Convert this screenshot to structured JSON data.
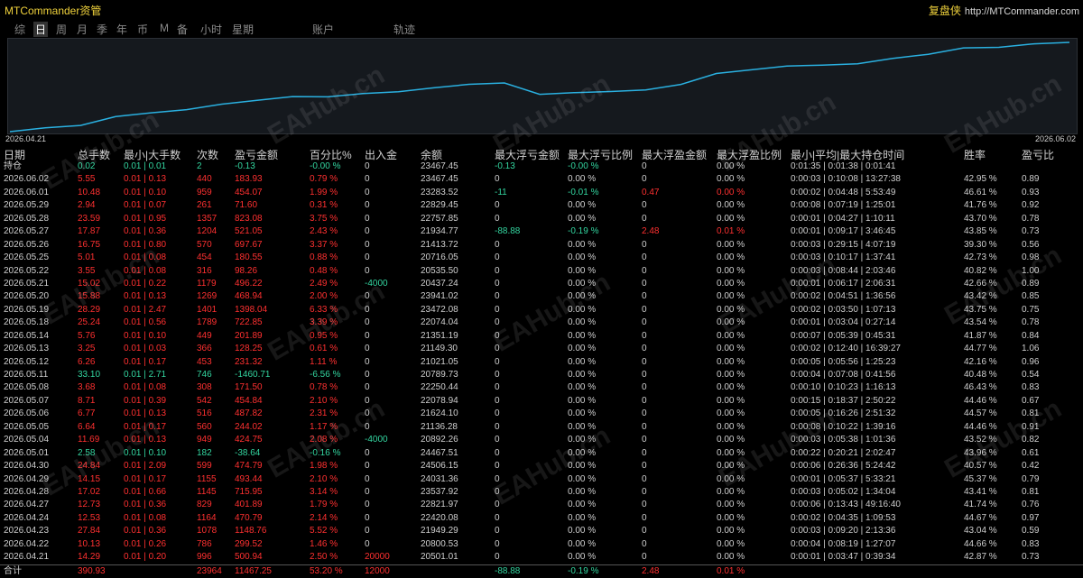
{
  "app": {
    "title": "MTCommander资管",
    "brand_cn": "复盘侠",
    "brand_url": "http://MTCommander.com"
  },
  "tabs": [
    "综",
    "日",
    "周",
    "月",
    "季",
    "年",
    "币",
    "M",
    "备",
    "小时",
    "星期",
    "账户",
    "轨迹"
  ],
  "active_tab": "日",
  "chart": {
    "start_date": "2026.04.21",
    "end_date": "2026.06.02",
    "line_color": "#2ab0e0",
    "series": [
      20501.01,
      20800.53,
      21949.29,
      22420.08,
      22821.97,
      23537.92,
      24031.36,
      24506.15,
      24467.51,
      20892.26,
      21136.28,
      21624.1,
      22078.94,
      22250.44,
      20789.73,
      21021.05,
      21149.3,
      21351.19,
      22074.04,
      23472.08,
      23941.02,
      20437.24,
      20535.5,
      20716.05,
      21413.72,
      21934.77,
      22757.85,
      22829.45,
      23283.52,
      23467.45
    ]
  },
  "headers": [
    "日期",
    "总手数",
    "最小|大手数",
    "次数",
    "盈亏金额",
    "百分比%",
    "出入金",
    "余额",
    "最大浮亏金额",
    "最大浮亏比例",
    "最大浮盈金额",
    "最大浮盈比例",
    "最小|平均|最大持仓时间",
    "胜率",
    "盈亏比"
  ],
  "rows": [
    {
      "date": "持仓",
      "lots": "0.02",
      "minmax": "0.01 | 0.01",
      "count": "2",
      "pnl": "-0.13",
      "pct": "-0.00 %",
      "flow": "0",
      "bal": "23467.45",
      "mfl": "-0.13",
      "mflp": "-0.00 %",
      "mfp": "0",
      "mfpp": "0.00 %",
      "hold": "0:01:35 | 0:01:38 | 0:01:41",
      "win": "",
      "rr": "",
      "c": "g"
    },
    {
      "date": "2026.06.02",
      "lots": "5.55",
      "minmax": "0.01 | 0.13",
      "count": "440",
      "pnl": "183.93",
      "pct": "0.79 %",
      "flow": "0",
      "bal": "23467.45",
      "mfl": "0",
      "mflp": "0.00 %",
      "mfp": "0",
      "mfpp": "0.00 %",
      "hold": "0:00:03 | 0:10:08 | 13:27:38",
      "win": "42.95 %",
      "rr": "0.89",
      "c": "r"
    },
    {
      "date": "2026.06.01",
      "lots": "10.48",
      "minmax": "0.01 | 0.10",
      "count": "959",
      "pnl": "454.07",
      "pct": "1.99 %",
      "flow": "0",
      "bal": "23283.52",
      "mfl": "-11",
      "mflp": "-0.01 %",
      "mfp": "0.47",
      "mfpp": "0.00 %",
      "hold": "0:00:02 | 0:04:48 | 5:53:49",
      "win": "46.61 %",
      "rr": "0.93",
      "c": "r"
    },
    {
      "date": "2026.05.29",
      "lots": "2.94",
      "minmax": "0.01 | 0.07",
      "count": "261",
      "pnl": "71.60",
      "pct": "0.31 %",
      "flow": "0",
      "bal": "22829.45",
      "mfl": "0",
      "mflp": "0.00 %",
      "mfp": "0",
      "mfpp": "0.00 %",
      "hold": "0:00:08 | 0:07:19 | 1:25:01",
      "win": "41.76 %",
      "rr": "0.92",
      "c": "r"
    },
    {
      "date": "2026.05.28",
      "lots": "23.59",
      "minmax": "0.01 | 0.95",
      "count": "1357",
      "pnl": "823.08",
      "pct": "3.75 %",
      "flow": "0",
      "bal": "22757.85",
      "mfl": "0",
      "mflp": "0.00 %",
      "mfp": "0",
      "mfpp": "0.00 %",
      "hold": "0:00:01 | 0:04:27 | 1:10:11",
      "win": "43.70 %",
      "rr": "0.78",
      "c": "r"
    },
    {
      "date": "2026.05.27",
      "lots": "17.87",
      "minmax": "0.01 | 0.36",
      "count": "1204",
      "pnl": "521.05",
      "pct": "2.43 %",
      "flow": "0",
      "bal": "21934.77",
      "mfl": "-88.88",
      "mflp": "-0.19 %",
      "mfp": "2.48",
      "mfpp": "0.01 %",
      "hold": "0:00:01 | 0:09:17 | 3:46:45",
      "win": "43.85 %",
      "rr": "0.73",
      "c": "r"
    },
    {
      "date": "2026.05.26",
      "lots": "16.75",
      "minmax": "0.01 | 0.80",
      "count": "570",
      "pnl": "697.67",
      "pct": "3.37 %",
      "flow": "0",
      "bal": "21413.72",
      "mfl": "0",
      "mflp": "0.00 %",
      "mfp": "0",
      "mfpp": "0.00 %",
      "hold": "0:00:03 | 0:29:15 | 4:07:19",
      "win": "39.30 %",
      "rr": "0.56",
      "c": "r"
    },
    {
      "date": "2026.05.25",
      "lots": "5.01",
      "minmax": "0.01 | 0.08",
      "count": "454",
      "pnl": "180.55",
      "pct": "0.88 %",
      "flow": "0",
      "bal": "20716.05",
      "mfl": "0",
      "mflp": "0.00 %",
      "mfp": "0",
      "mfpp": "0.00 %",
      "hold": "0:00:03 | 0:10:17 | 1:37:41",
      "win": "42.73 %",
      "rr": "0.98",
      "c": "r"
    },
    {
      "date": "2026.05.22",
      "lots": "3.55",
      "minmax": "0.01 | 0.08",
      "count": "316",
      "pnl": "98.26",
      "pct": "0.48 %",
      "flow": "0",
      "bal": "20535.50",
      "mfl": "0",
      "mflp": "0.00 %",
      "mfp": "0",
      "mfpp": "0.00 %",
      "hold": "0:00:03 | 0:08:44 | 2:03:46",
      "win": "40.82 %",
      "rr": "1.00",
      "c": "r"
    },
    {
      "date": "2026.05.21",
      "lots": "15.02",
      "minmax": "0.01 | 0.22",
      "count": "1179",
      "pnl": "496.22",
      "pct": "2.49 %",
      "flow": "-4000",
      "bal": "20437.24",
      "mfl": "0",
      "mflp": "0.00 %",
      "mfp": "0",
      "mfpp": "0.00 %",
      "hold": "0:00:01 | 0:06:17 | 2:06:31",
      "win": "42.66 %",
      "rr": "0.89",
      "c": "r"
    },
    {
      "date": "2026.05.20",
      "lots": "15.88",
      "minmax": "0.01 | 0.13",
      "count": "1269",
      "pnl": "468.94",
      "pct": "2.00 %",
      "flow": "0",
      "bal": "23941.02",
      "mfl": "0",
      "mflp": "0.00 %",
      "mfp": "0",
      "mfpp": "0.00 %",
      "hold": "0:00:02 | 0:04:51 | 1:36:56",
      "win": "43.42 %",
      "rr": "0.85",
      "c": "r"
    },
    {
      "date": "2026.05.19",
      "lots": "28.29",
      "minmax": "0.01 | 2.47",
      "count": "1401",
      "pnl": "1398.04",
      "pct": "6.33 %",
      "flow": "0",
      "bal": "23472.08",
      "mfl": "0",
      "mflp": "0.00 %",
      "mfp": "0",
      "mfpp": "0.00 %",
      "hold": "0:00:02 | 0:03:50 | 1:07:13",
      "win": "43.75 %",
      "rr": "0.75",
      "c": "r"
    },
    {
      "date": "2026.05.18",
      "lots": "25.24",
      "minmax": "0.01 | 0.56",
      "count": "1789",
      "pnl": "722.85",
      "pct": "3.39 %",
      "flow": "0",
      "bal": "22074.04",
      "mfl": "0",
      "mflp": "0.00 %",
      "mfp": "0",
      "mfpp": "0.00 %",
      "hold": "0:00:01 | 0:03:04 | 0:27:14",
      "win": "43.54 %",
      "rr": "0.78",
      "c": "r"
    },
    {
      "date": "2026.05.14",
      "lots": "5.76",
      "minmax": "0.01 | 0.10",
      "count": "449",
      "pnl": "201.89",
      "pct": "0.95 %",
      "flow": "0",
      "bal": "21351.19",
      "mfl": "0",
      "mflp": "0.00 %",
      "mfp": "0",
      "mfpp": "0.00 %",
      "hold": "0:00:07 | 0:05:39 | 0:45:31",
      "win": "41.87 %",
      "rr": "0.84",
      "c": "r"
    },
    {
      "date": "2026.05.13",
      "lots": "3.25",
      "minmax": "0.01 | 0.03",
      "count": "366",
      "pnl": "128.25",
      "pct": "0.61 %",
      "flow": "0",
      "bal": "21149.30",
      "mfl": "0",
      "mflp": "0.00 %",
      "mfp": "0",
      "mfpp": "0.00 %",
      "hold": "0:00:02 | 0:12:40 | 16:39:27",
      "win": "44.77 %",
      "rr": "1.06",
      "c": "r"
    },
    {
      "date": "2026.05.12",
      "lots": "6.26",
      "minmax": "0.01 | 0.17",
      "count": "453",
      "pnl": "231.32",
      "pct": "1.11 %",
      "flow": "0",
      "bal": "21021.05",
      "mfl": "0",
      "mflp": "0.00 %",
      "mfp": "0",
      "mfpp": "0.00 %",
      "hold": "0:00:05 | 0:05:56 | 1:25:23",
      "win": "42.16 %",
      "rr": "0.96",
      "c": "r"
    },
    {
      "date": "2026.05.11",
      "lots": "33.10",
      "minmax": "0.01 | 2.71",
      "count": "746",
      "pnl": "-1460.71",
      "pct": "-6.56 %",
      "flow": "0",
      "bal": "20789.73",
      "mfl": "0",
      "mflp": "0.00 %",
      "mfp": "0",
      "mfpp": "0.00 %",
      "hold": "0:00:04 | 0:07:08 | 0:41:56",
      "win": "40.48 %",
      "rr": "0.54",
      "c": "g"
    },
    {
      "date": "2026.05.08",
      "lots": "3.68",
      "minmax": "0.01 | 0.08",
      "count": "308",
      "pnl": "171.50",
      "pct": "0.78 %",
      "flow": "0",
      "bal": "22250.44",
      "mfl": "0",
      "mflp": "0.00 %",
      "mfp": "0",
      "mfpp": "0.00 %",
      "hold": "0:00:10 | 0:10:23 | 1:16:13",
      "win": "46.43 %",
      "rr": "0.83",
      "c": "r"
    },
    {
      "date": "2026.05.07",
      "lots": "8.71",
      "minmax": "0.01 | 0.39",
      "count": "542",
      "pnl": "454.84",
      "pct": "2.10 %",
      "flow": "0",
      "bal": "22078.94",
      "mfl": "0",
      "mflp": "0.00 %",
      "mfp": "0",
      "mfpp": "0.00 %",
      "hold": "0:00:15 | 0:18:37 | 2:50:22",
      "win": "44.46 %",
      "rr": "0.67",
      "c": "r"
    },
    {
      "date": "2026.05.06",
      "lots": "6.77",
      "minmax": "0.01 | 0.13",
      "count": "516",
      "pnl": "487.82",
      "pct": "2.31 %",
      "flow": "0",
      "bal": "21624.10",
      "mfl": "0",
      "mflp": "0.00 %",
      "mfp": "0",
      "mfpp": "0.00 %",
      "hold": "0:00:05 | 0:16:26 | 2:51:32",
      "win": "44.57 %",
      "rr": "0.81",
      "c": "r"
    },
    {
      "date": "2026.05.05",
      "lots": "6.64",
      "minmax": "0.01 | 0.17",
      "count": "560",
      "pnl": "244.02",
      "pct": "1.17 %",
      "flow": "0",
      "bal": "21136.28",
      "mfl": "0",
      "mflp": "0.00 %",
      "mfp": "0",
      "mfpp": "0.00 %",
      "hold": "0:00:08 | 0:10:22 | 1:39:16",
      "win": "44.46 %",
      "rr": "0.91",
      "c": "r"
    },
    {
      "date": "2026.05.04",
      "lots": "11.69",
      "minmax": "0.01 | 0.13",
      "count": "949",
      "pnl": "424.75",
      "pct": "2.08 %",
      "flow": "-4000",
      "bal": "20892.26",
      "mfl": "0",
      "mflp": "0.00 %",
      "mfp": "0",
      "mfpp": "0.00 %",
      "hold": "0:00:03 | 0:05:38 | 1:01:36",
      "win": "43.52 %",
      "rr": "0.82",
      "c": "r"
    },
    {
      "date": "2026.05.01",
      "lots": "2.58",
      "minmax": "0.01 | 0.10",
      "count": "182",
      "pnl": "-38.64",
      "pct": "-0.16 %",
      "flow": "0",
      "bal": "24467.51",
      "mfl": "0",
      "mflp": "0.00 %",
      "mfp": "0",
      "mfpp": "0.00 %",
      "hold": "0:00:22 | 0:20:21 | 2:02:47",
      "win": "43.96 %",
      "rr": "0.61",
      "c": "g"
    },
    {
      "date": "2026.04.30",
      "lots": "24.84",
      "minmax": "0.01 | 2.09",
      "count": "599",
      "pnl": "474.79",
      "pct": "1.98 %",
      "flow": "0",
      "bal": "24506.15",
      "mfl": "0",
      "mflp": "0.00 %",
      "mfp": "0",
      "mfpp": "0.00 %",
      "hold": "0:00:06 | 0:26:36 | 5:24:42",
      "win": "40.57 %",
      "rr": "0.42",
      "c": "r"
    },
    {
      "date": "2026.04.29",
      "lots": "14.15",
      "minmax": "0.01 | 0.17",
      "count": "1155",
      "pnl": "493.44",
      "pct": "2.10 %",
      "flow": "0",
      "bal": "24031.36",
      "mfl": "0",
      "mflp": "0.00 %",
      "mfp": "0",
      "mfpp": "0.00 %",
      "hold": "0:00:01 | 0:05:37 | 5:33:21",
      "win": "45.37 %",
      "rr": "0.79",
      "c": "r"
    },
    {
      "date": "2026.04.28",
      "lots": "17.02",
      "minmax": "0.01 | 0.66",
      "count": "1145",
      "pnl": "715.95",
      "pct": "3.14 %",
      "flow": "0",
      "bal": "23537.92",
      "mfl": "0",
      "mflp": "0.00 %",
      "mfp": "0",
      "mfpp": "0.00 %",
      "hold": "0:00:03 | 0:05:02 | 1:34:04",
      "win": "43.41 %",
      "rr": "0.81",
      "c": "r"
    },
    {
      "date": "2026.04.27",
      "lots": "12.73",
      "minmax": "0.01 | 0.36",
      "count": "829",
      "pnl": "401.89",
      "pct": "1.79 %",
      "flow": "0",
      "bal": "22821.97",
      "mfl": "0",
      "mflp": "0.00 %",
      "mfp": "0",
      "mfpp": "0.00 %",
      "hold": "0:00:06 | 0:13:43 | 49:16:40",
      "win": "41.74 %",
      "rr": "0.76",
      "c": "r"
    },
    {
      "date": "2026.04.24",
      "lots": "12.53",
      "minmax": "0.01 | 0.08",
      "count": "1164",
      "pnl": "470.79",
      "pct": "2.14 %",
      "flow": "0",
      "bal": "22420.08",
      "mfl": "0",
      "mflp": "0.00 %",
      "mfp": "0",
      "mfpp": "0.00 %",
      "hold": "0:00:02 | 0:04:35 | 1:09:53",
      "win": "44.67 %",
      "rr": "0.97",
      "c": "r"
    },
    {
      "date": "2026.04.23",
      "lots": "27.84",
      "minmax": "0.01 | 0.36",
      "count": "1078",
      "pnl": "1148.76",
      "pct": "5.52 %",
      "flow": "0",
      "bal": "21949.29",
      "mfl": "0",
      "mflp": "0.00 %",
      "mfp": "0",
      "mfpp": "0.00 %",
      "hold": "0:00:03 | 0:09:20 | 2:13:36",
      "win": "43.04 %",
      "rr": "0.59",
      "c": "r"
    },
    {
      "date": "2026.04.22",
      "lots": "10.13",
      "minmax": "0.01 | 0.26",
      "count": "786",
      "pnl": "299.52",
      "pct": "1.46 %",
      "flow": "0",
      "bal": "20800.53",
      "mfl": "0",
      "mflp": "0.00 %",
      "mfp": "0",
      "mfpp": "0.00 %",
      "hold": "0:00:04 | 0:08:19 | 1:27:07",
      "win": "44.66 %",
      "rr": "0.83",
      "c": "r"
    },
    {
      "date": "2026.04.21",
      "lots": "14.29",
      "minmax": "0.01 | 0.20",
      "count": "996",
      "pnl": "500.94",
      "pct": "2.50 %",
      "flow": "20000",
      "bal": "20501.01",
      "mfl": "0",
      "mflp": "0.00 %",
      "mfp": "0",
      "mfpp": "0.00 %",
      "hold": "0:00:01 | 0:03:47 | 0:39:34",
      "win": "42.87 %",
      "rr": "0.73",
      "c": "r"
    }
  ],
  "total": {
    "date": "合计",
    "lots": "390.93",
    "minmax": "",
    "count": "23964",
    "pnl": "11467.25",
    "pct": "53.20 %",
    "flow": "12000",
    "bal": "",
    "mfl": "-88.88",
    "mflp": "-0.19 %",
    "mfp": "2.48",
    "mfpp": "0.01 %",
    "hold": "",
    "win": "",
    "rr": ""
  },
  "watermark": "EAHub.cn"
}
